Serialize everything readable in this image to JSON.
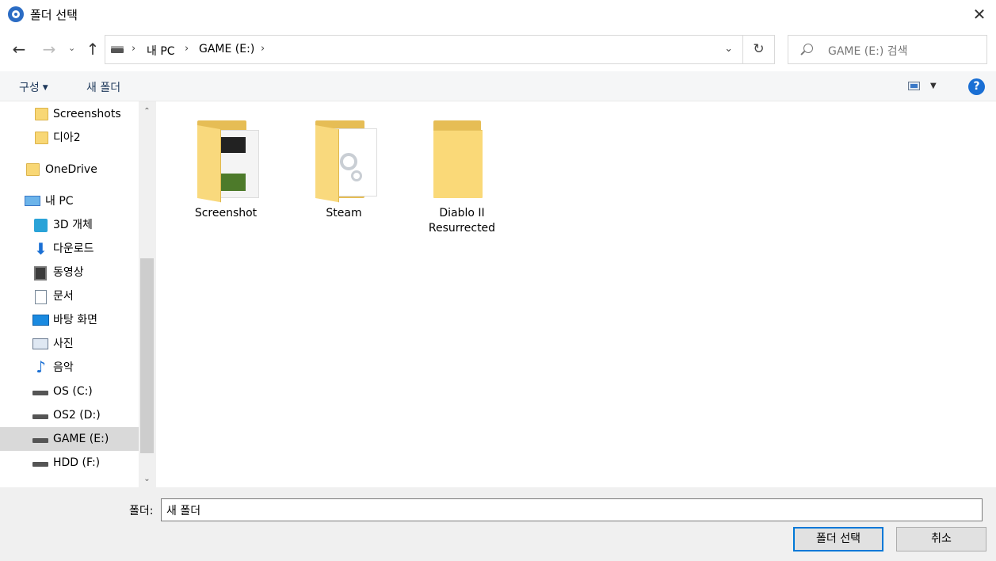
{
  "window": {
    "title": "폴더 선택",
    "close_glyph": "✕"
  },
  "nav": {
    "back_glyph": "←",
    "forward_glyph": "→",
    "recent_glyph": "⌄",
    "up_glyph": "↑",
    "breadcrumbs": [
      "내 PC",
      "GAME (E:)"
    ],
    "separator": "›",
    "dropdown_glyph": "⌄",
    "refresh_glyph": "↻",
    "search_placeholder": "GAME (E:) 검색"
  },
  "toolbar": {
    "organize_label": "구성",
    "new_folder_label": "새 폴더",
    "caret": "▼",
    "help_glyph": "?"
  },
  "sidebar": {
    "items": [
      {
        "label": "Screenshots",
        "icon": "folder-icon"
      },
      {
        "label": "디아2",
        "icon": "folder-icon"
      },
      {
        "label": "OneDrive",
        "icon": "folder-icon"
      },
      {
        "label": "내 PC",
        "icon": "pc-icon"
      },
      {
        "label": "3D 개체",
        "icon": "3d-objects-icon"
      },
      {
        "label": "다운로드",
        "icon": "download-icon"
      },
      {
        "label": "동영상",
        "icon": "video-icon"
      },
      {
        "label": "문서",
        "icon": "document-icon"
      },
      {
        "label": "바탕 화면",
        "icon": "desktop-icon"
      },
      {
        "label": "사진",
        "icon": "picture-icon"
      },
      {
        "label": "음악",
        "icon": "music-icon"
      },
      {
        "label": "OS (C:)",
        "icon": "windows-drive-icon"
      },
      {
        "label": "OS2 (D:)",
        "icon": "drive-icon"
      },
      {
        "label": "GAME (E:)",
        "icon": "drive-icon",
        "selected": true
      },
      {
        "label": "HDD (F:)",
        "icon": "drive-icon"
      }
    ],
    "scroll_up": "⌃",
    "scroll_down": "⌄"
  },
  "content": {
    "items": [
      {
        "label": "Screenshot",
        "type": "folder-with-images"
      },
      {
        "label": "Steam",
        "type": "folder-with-settings"
      },
      {
        "label": "Diablo II Resurrected",
        "type": "empty-folder"
      }
    ]
  },
  "footer": {
    "folder_label": "폴더:",
    "folder_value": "새 폴더",
    "select_button": "폴더 선택",
    "cancel_button": "취소"
  },
  "colors": {
    "accent": "#0078d7",
    "folder": "#f8d775",
    "selected_bg": "#d9d9d9",
    "help": "#1a6fd4"
  }
}
